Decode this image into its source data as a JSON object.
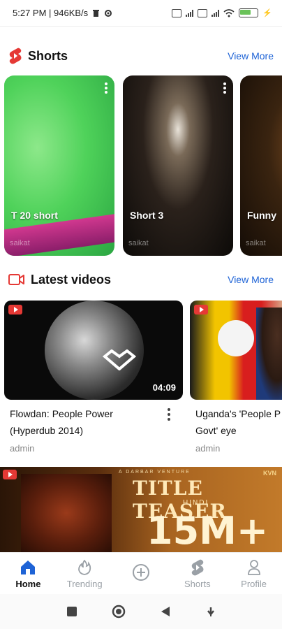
{
  "status_bar": {
    "time_info": "5:27 PM | 946KB/s",
    "battery": "67",
    "battery_level": 0.67
  },
  "shorts": {
    "title": "Shorts",
    "view_more": "View More",
    "items": [
      {
        "title": "T 20 short",
        "author": "saikat"
      },
      {
        "title": "Short 3",
        "author": "saikat"
      },
      {
        "title": "Funny",
        "author": "saikat"
      }
    ]
  },
  "latest": {
    "title": "Latest videos",
    "view_more": "View More",
    "videos": [
      {
        "title": "Flowdan: People Power (Hyperdub 2014)",
        "author": "admin",
        "duration": "04:09"
      },
      {
        "title": "Uganda's 'People P 'People's Govt' eye",
        "author": "admin",
        "duration": ""
      }
    ]
  },
  "banner": {
    "title": "TITLE TEASER",
    "subtitle": "HINDI",
    "big": "15M+",
    "top_text": "A DARBAR VENTURE",
    "logo": "KVN"
  },
  "bottom_nav": {
    "items": [
      {
        "label": "Home",
        "icon": "home-icon"
      },
      {
        "label": "Trending",
        "icon": "flame-icon"
      },
      {
        "label": "",
        "icon": "add-circle-icon"
      },
      {
        "label": "Shorts",
        "icon": "shorts-icon"
      },
      {
        "label": "Profile",
        "icon": "person-icon"
      }
    ]
  },
  "colors": {
    "accent": "#1e63d6",
    "shorts_red": "#e53935",
    "text_dark": "#111111",
    "inactive": "#9aa0a6"
  }
}
